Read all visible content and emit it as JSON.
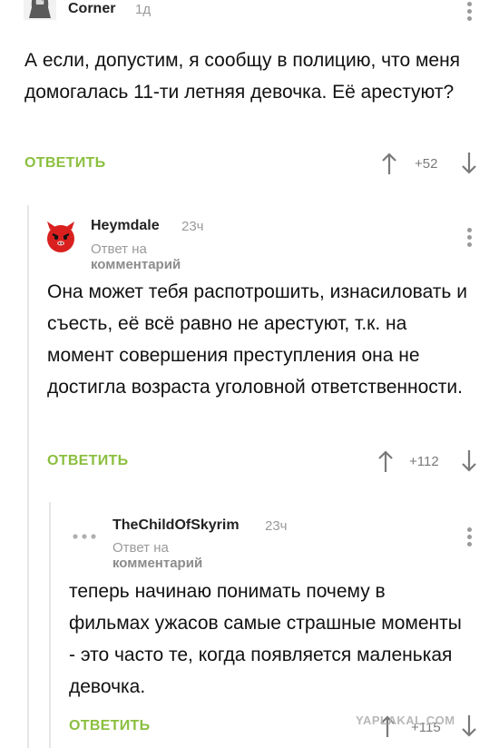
{
  "comments": [
    {
      "author": "Corner",
      "time": "1д",
      "text": "А если, допустим, я сообщу в полицию, что меня домогалась 11-ти летняя девочка. Её арестуют?",
      "reply_label": "ОТВЕТИТЬ",
      "rating": "+52"
    },
    {
      "author": "Heymdale",
      "time": "23ч",
      "reply_prefix": "Ответ на",
      "reply_target": "комментарий",
      "text": "Она может тебя распотрошить, изнасиловать и съесть, её всё равно не арестуют, т.к. на момент совершения преступления она не достигла возраста уголовной ответственности.",
      "reply_label": "ОТВЕТИТЬ",
      "rating": "+112"
    },
    {
      "author": "TheChildOfSkyrim",
      "time": "23ч",
      "reply_prefix": "Ответ на",
      "reply_target": "комментарий",
      "text": "теперь начинаю понимать почему в фильмах ужасов самые страшные моменты - это часто те, когда появляется маленькая девочка.",
      "reply_label": "ОТВЕТИТЬ",
      "rating": "+115"
    }
  ],
  "watermark": "YAPLAKAL.COM",
  "colors": {
    "accent": "#8bbf3f",
    "muted": "#9a9a9a",
    "rail": "#e6e6e6",
    "avatar_red": "#d9201f"
  },
  "icons": [
    "hooded-figure-avatar",
    "red-devil-avatar",
    "dots-avatar",
    "kebab-menu-icon",
    "arrow-up-icon",
    "arrow-down-icon"
  ]
}
